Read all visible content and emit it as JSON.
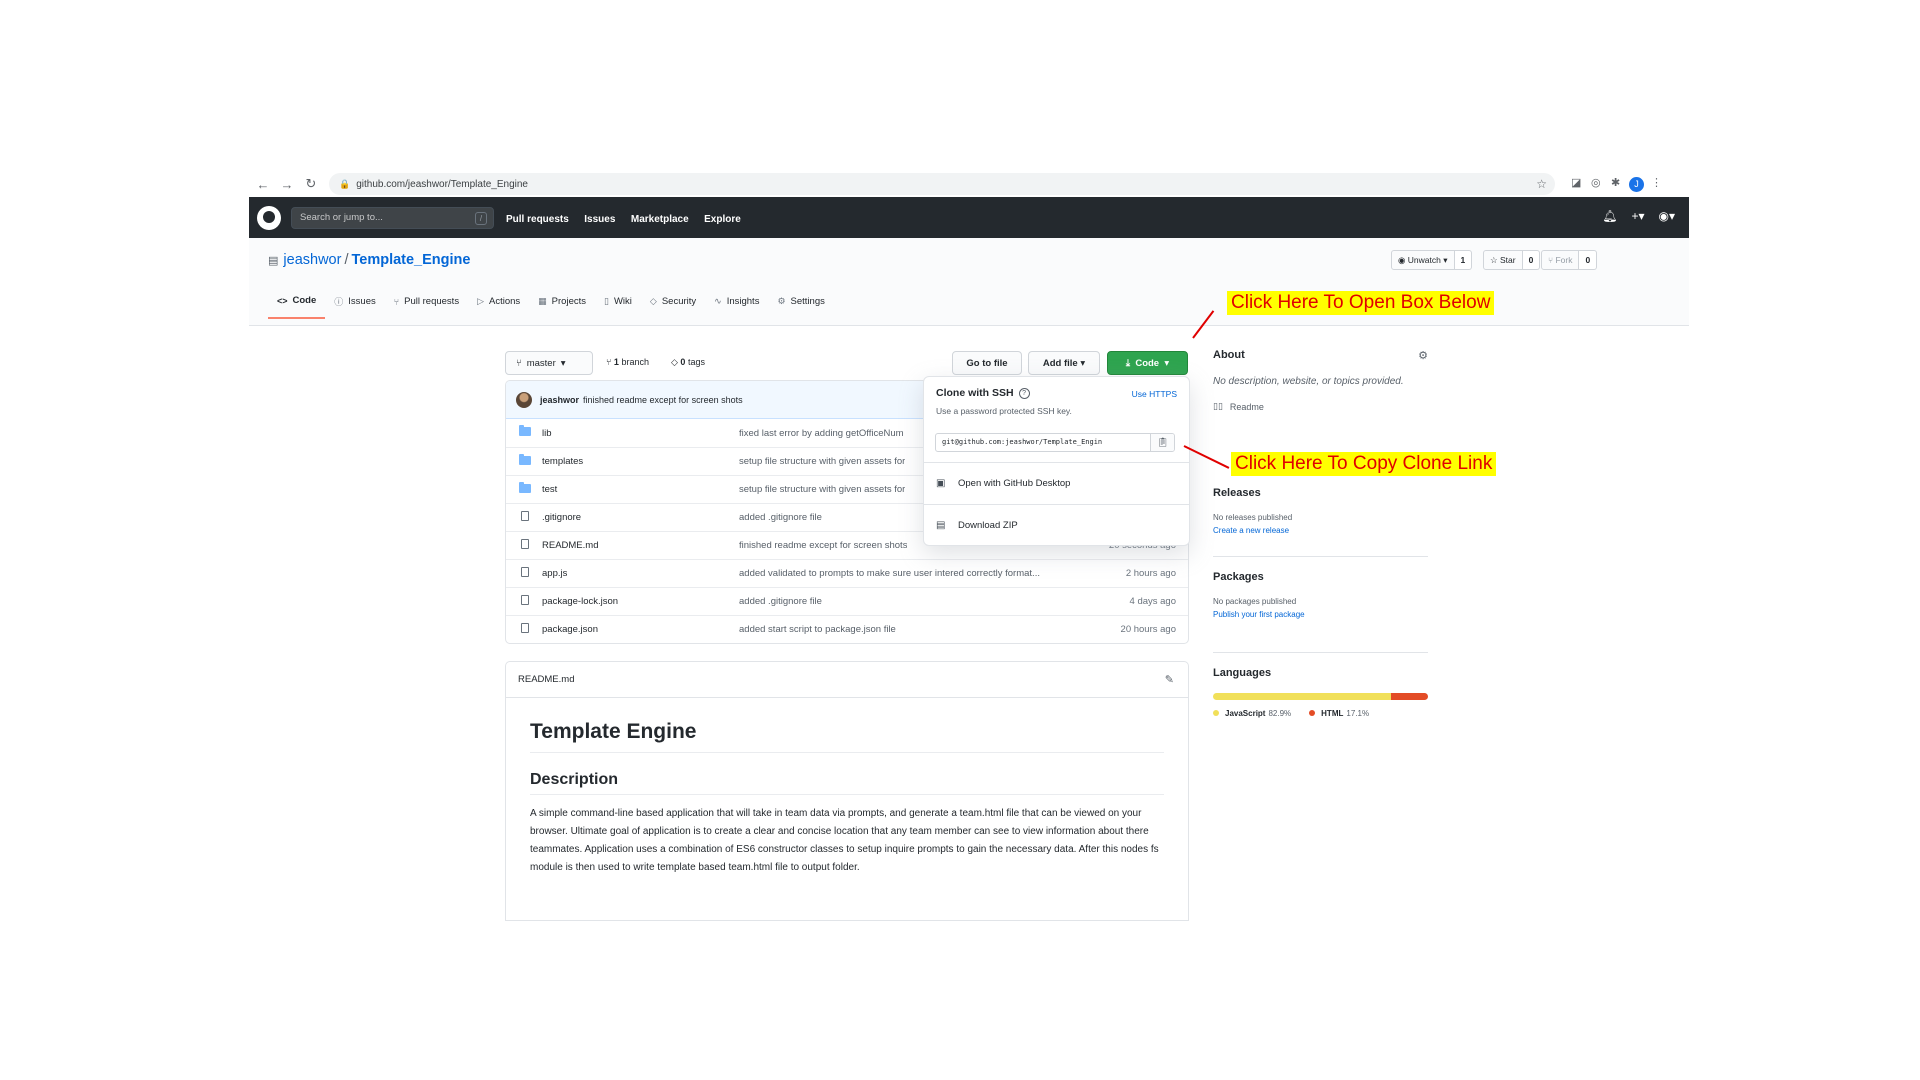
{
  "browser": {
    "url": "github.com/jeashwor/Template_Engine",
    "profile_initial": "J"
  },
  "header": {
    "search_placeholder": "Search or jump to...",
    "search_shortcut": "/",
    "nav": [
      "Pull requests",
      "Issues",
      "Marketplace",
      "Explore"
    ]
  },
  "repo": {
    "owner": "jeashwor",
    "separator": "/",
    "name": "Template_Engine",
    "watch_label": "Unwatch",
    "watch_count": "1",
    "star_label": "Star",
    "star_count": "0",
    "fork_label": "Fork",
    "fork_count": "0",
    "tabs": [
      {
        "label": "Code",
        "icon": "<>"
      },
      {
        "label": "Issues",
        "icon": "ⓘ"
      },
      {
        "label": "Pull requests",
        "icon": "⑂"
      },
      {
        "label": "Actions",
        "icon": "▷"
      },
      {
        "label": "Projects",
        "icon": "▦"
      },
      {
        "label": "Wiki",
        "icon": "▯"
      },
      {
        "label": "Security",
        "icon": "◇"
      },
      {
        "label": "Insights",
        "icon": "∿"
      },
      {
        "label": "Settings",
        "icon": "⚙"
      }
    ]
  },
  "toolbar": {
    "branch": "master",
    "branches_count": "1",
    "branches_label": "branch",
    "tags_count": "0",
    "tags_label": "tags",
    "go_to_file": "Go to file",
    "add_file": "Add file",
    "code": "Code"
  },
  "commit": {
    "author": "jeashwor",
    "message": "finished readme except for screen shots"
  },
  "files": [
    {
      "name": "lib",
      "type": "folder",
      "message": "fixed last error by adding getOfficeNum",
      "age": ""
    },
    {
      "name": "templates",
      "type": "folder",
      "message": "setup file structure with given assets for",
      "age": ""
    },
    {
      "name": "test",
      "type": "folder",
      "message": "setup file structure with given assets for",
      "age": ""
    },
    {
      "name": ".gitignore",
      "type": "file",
      "message": "added .gitignore file",
      "age": ""
    },
    {
      "name": "README.md",
      "type": "file",
      "message": "finished readme except for screen shots",
      "age": "20 seconds ago"
    },
    {
      "name": "app.js",
      "type": "file",
      "message": "added validated to prompts to make sure user intered correctly format...",
      "age": "2 hours ago"
    },
    {
      "name": "package-lock.json",
      "type": "file",
      "message": "added .gitignore file",
      "age": "4 days ago"
    },
    {
      "name": "package.json",
      "type": "file",
      "message": "added start script to package.json file",
      "age": "20 hours ago"
    }
  ],
  "clone": {
    "title": "Clone with SSH",
    "switch": "Use HTTPS",
    "subtitle": "Use a password protected SSH key.",
    "url": "git@github.com:jeashwor/Template_Engin",
    "desktop": "Open with GitHub Desktop",
    "zip": "Download ZIP"
  },
  "readme": {
    "filename": "README.md",
    "h1": "Template Engine",
    "h2": "Description",
    "body": "A simple command-line based application that will take in team data via prompts, and generate a team.html file that can be viewed on your browser. Ultimate goal of application is to create a clear and concise location that any team member can see to view information about there teammates. Application uses a combination of ES6 constructor classes to setup inquire prompts to gain the necessary data. After this nodes fs module is then used to write template based team.html file to output folder."
  },
  "sidebar": {
    "about_title": "About",
    "about_desc": "No description, website, or topics provided.",
    "readme_label": "Readme",
    "releases_title": "Releases",
    "releases_none": "No releases published",
    "releases_link": "Create a new release",
    "packages_title": "Packages",
    "packages_none": "No packages published",
    "packages_link": "Publish your first package",
    "languages_title": "Languages",
    "languages": [
      {
        "name": "JavaScript",
        "percent": "82.9%",
        "value": 82.9,
        "color": "#f1e05a"
      },
      {
        "name": "HTML",
        "percent": "17.1%",
        "value": 17.1,
        "color": "#e34c26"
      }
    ]
  },
  "annotations": {
    "top": "Click Here To Open Box Below",
    "copy": "Click Here To Copy Clone Link"
  },
  "colors": {
    "annotation_bg": "#ffff00",
    "annotation_text": "#e00000",
    "code_button": "#2ea44f",
    "tab_active": "#f9826c"
  }
}
